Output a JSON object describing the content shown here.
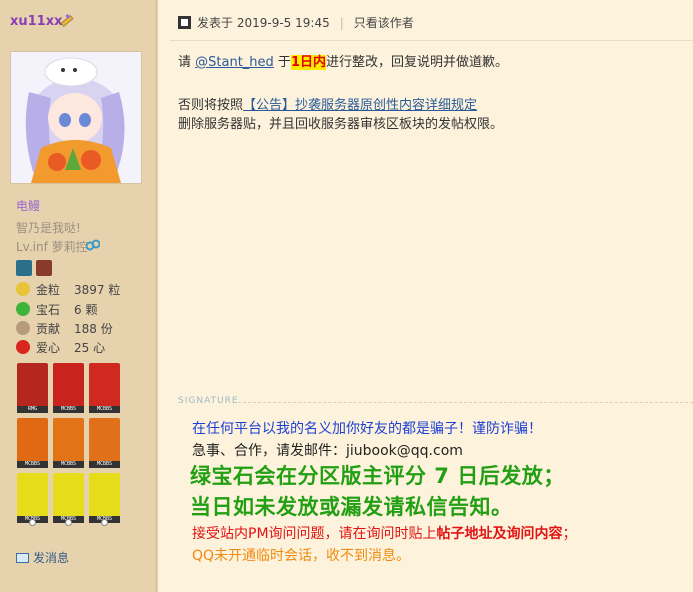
{
  "user": {
    "name": "xu11xx",
    "group": "电鳗",
    "custom_title": "智乃是我哒!",
    "level": "Lv.inf 萝莉控",
    "stats": [
      {
        "label": "金粒",
        "value": "3897 粒",
        "icon": "gold-nugget-icon",
        "color": "#e9c43a"
      },
      {
        "label": "宝石",
        "value": "6 颗",
        "icon": "emerald-icon",
        "color": "#3fb43a"
      },
      {
        "label": "贡献",
        "value": "188 份",
        "icon": "contribution-icon",
        "color": "#b79a7a"
      },
      {
        "label": "爱心",
        "value": "25 心",
        "icon": "apple-heart-icon",
        "color": "#d8261e"
      }
    ],
    "medals": [
      {
        "tag": "RMG",
        "color": "#b5261e",
        "icon": "rmg-medal-icon"
      },
      {
        "tag": "MCBBS",
        "color": "#c8231c",
        "icon": "java-medal-icon"
      },
      {
        "tag": "MCBBS",
        "color": "#d02a20",
        "icon": "windows-medal-icon"
      },
      {
        "tag": "MCBBS",
        "color": "#e06a13",
        "icon": "wheat-seeds-medal-icon"
      },
      {
        "tag": "MCBBS",
        "color": "#e27317",
        "icon": "sapling-medal-icon"
      },
      {
        "tag": "MCBBS",
        "color": "#e0701a",
        "icon": "nether-wart-medal-icon"
      },
      {
        "tag": "MCBBS",
        "color": "#e6dc1a",
        "icon": "stone-pickaxe-medal-icon"
      },
      {
        "tag": "MCBBS",
        "color": "#e6dc1a",
        "icon": "iron-pickaxe-medal-icon"
      },
      {
        "tag": "MCBBS",
        "color": "#e6dc1a",
        "icon": "diamond-pickaxe-medal-icon"
      }
    ],
    "pm_label": "发消息"
  },
  "post": {
    "posted_prefix": "发表于",
    "posted_time": "2019-9-5 19:45",
    "author_only": "只看该作者",
    "line1_pre": "请 ",
    "mention": "@Stant_hed",
    "line1_mid": " 于",
    "deadline": "1日内",
    "line1_post": "进行整改，回复说明并做道歉。",
    "line2_pre": "否则将按照",
    "rule_link": "【公告】抄袭服务器原创性内容详细规定",
    "line3": "删除服务器贴，并且回收服务器审核区板块的发帖权限。"
  },
  "signature": {
    "label": "SIGNATURE",
    "l1": "在任何平台以我的名义加你好友的都是骗子！谨防诈骗！",
    "l2": "急事、合作，请发邮件：jiubook@qq.com",
    "l3": "绿宝石会在分区版主评分 7 日后发放；",
    "l4": "当日如未发放或漏发请私信告知。",
    "l5_pre": "接受站内PM询问问题，请在询问时贴上",
    "l5_bold": "帖子地址及询问内容",
    "l5_post": "；",
    "l6": "QQ未开通临时会话，收不到消息。"
  }
}
